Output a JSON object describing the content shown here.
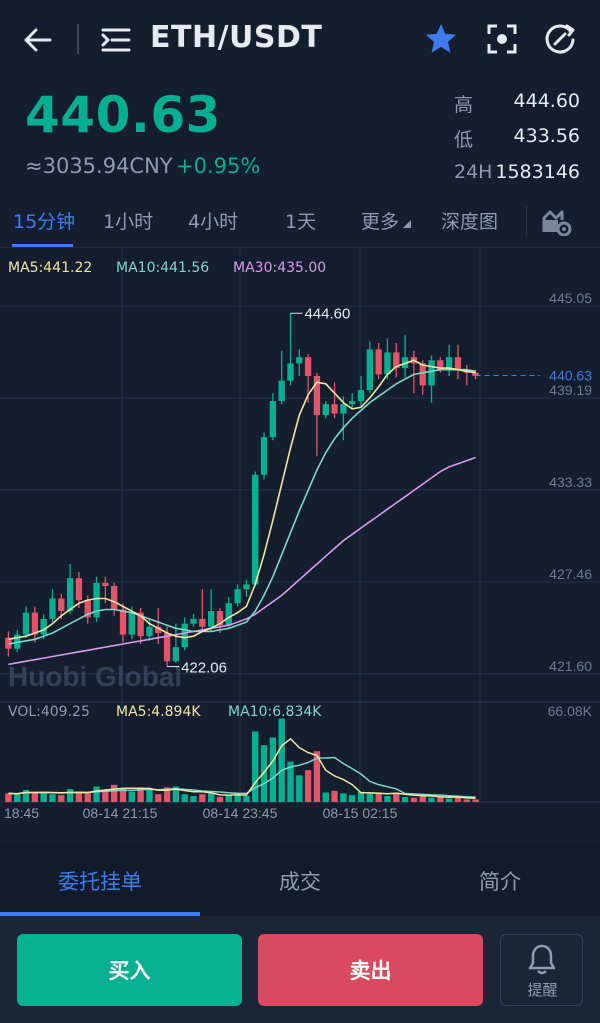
{
  "header": {
    "pair": "ETH/USDT"
  },
  "ticker": {
    "last": "440.63",
    "cny": "≈3035.94CNY",
    "change": "+0.95%",
    "stats": [
      {
        "label": "高",
        "value": "444.60"
      },
      {
        "label": "低",
        "value": "433.56"
      },
      {
        "label": "24H",
        "value": "1583146"
      }
    ]
  },
  "tabs": [
    "15分钟",
    "1小时",
    "4小时",
    "1天",
    "更多",
    "深度图"
  ],
  "chart_legend": {
    "ma5": "MA5:441.22",
    "ma10": "MA10:441.56",
    "ma30": "MA30:435.00",
    "vol": "VOL:409.25",
    "vol_ma5": "MA5:4.894K",
    "vol_ma10": "MA10:6.834K"
  },
  "watermark": "Huobi Global",
  "colors": {
    "up": "#05b092",
    "down": "#e2546a",
    "accent": "#3d7cf0",
    "ma5": "#f3e6a2",
    "ma10": "#7fd8c8",
    "ma30": "#d99af0"
  },
  "chart_data": {
    "type": "candlestick",
    "price_axis": {
      "ticks": [
        "445.05",
        "439.19",
        "433.33",
        "427.46",
        "421.60"
      ],
      "range": [
        419.8,
        448.7
      ]
    },
    "volume_axis": {
      "max_label": "66.08K"
    },
    "x_ticks": [
      "18:45",
      "08-14 21:15",
      "08-14 23:45",
      "08-15 02:15"
    ],
    "high_annotation": "444.60",
    "low_annotation": "422.06",
    "last_price_tag": "440.63",
    "candles": [
      [
        423.9,
        423.2,
        424.3,
        422.7
      ],
      [
        423.2,
        424.1,
        424.4,
        423.0
      ],
      [
        424.1,
        425.5,
        425.9,
        423.9
      ],
      [
        425.5,
        424.1,
        425.9,
        423.6
      ],
      [
        424.1,
        425.1,
        425.4,
        423.8
      ],
      [
        425.1,
        426.4,
        427.0,
        424.9
      ],
      [
        426.4,
        425.6,
        426.7,
        425.1
      ],
      [
        425.6,
        427.7,
        428.6,
        425.4
      ],
      [
        427.7,
        426.3,
        428.1,
        425.8
      ],
      [
        426.3,
        425.2,
        426.6,
        424.8
      ],
      [
        425.2,
        427.4,
        427.8,
        424.9
      ],
      [
        427.4,
        427.2,
        427.8,
        426.1
      ],
      [
        427.2,
        425.7,
        427.4,
        425.3
      ],
      [
        425.7,
        424.1,
        426.1,
        423.6
      ],
      [
        424.1,
        425.5,
        425.9,
        423.8
      ],
      [
        425.5,
        424.0,
        425.8,
        423.5
      ],
      [
        424.0,
        424.6,
        425.1,
        423.7
      ],
      [
        424.6,
        424.2,
        425.8,
        423.5
      ],
      [
        424.2,
        422.4,
        424.6,
        422.06
      ],
      [
        422.4,
        423.3,
        424.8,
        422.3
      ],
      [
        423.3,
        424.8,
        425.2,
        423.1
      ],
      [
        424.8,
        425.1,
        425.4,
        424.6
      ],
      [
        425.1,
        424.6,
        427.0,
        424.3
      ],
      [
        424.6,
        425.6,
        427.0,
        424.3
      ],
      [
        425.6,
        424.7,
        425.8,
        424.2
      ],
      [
        424.7,
        426.1,
        426.5,
        424.6
      ],
      [
        426.1,
        427.0,
        427.3,
        425.9
      ],
      [
        427.0,
        427.3,
        427.6,
        426.5
      ],
      [
        427.3,
        434.3,
        434.5,
        427.2
      ],
      [
        434.3,
        436.7,
        437.0,
        434.0
      ],
      [
        436.7,
        439.0,
        439.5,
        436.5
      ],
      [
        439.0,
        440.3,
        442.2,
        438.8
      ],
      [
        440.3,
        441.4,
        444.6,
        440.0
      ],
      [
        441.4,
        441.8,
        442.3,
        440.6
      ],
      [
        441.8,
        440.6,
        442.0,
        438.9
      ],
      [
        440.6,
        438.1,
        440.8,
        435.5
      ],
      [
        438.1,
        438.8,
        439.0,
        437.9
      ],
      [
        438.8,
        438.2,
        440.2,
        437.9
      ],
      [
        438.2,
        438.8,
        439.3,
        436.5
      ],
      [
        438.8,
        439.0,
        439.5,
        438.5
      ],
      [
        439.0,
        439.7,
        440.6,
        438.6
      ],
      [
        439.7,
        442.3,
        442.8,
        439.5
      ],
      [
        442.3,
        440.7,
        442.7,
        440.4
      ],
      [
        440.7,
        442.1,
        443.0,
        440.4
      ],
      [
        442.1,
        441.1,
        442.7,
        440.5
      ],
      [
        441.1,
        441.8,
        443.2,
        440.5
      ],
      [
        441.8,
        441.4,
        442.2,
        439.5
      ],
      [
        441.4,
        440.0,
        441.6,
        439.4
      ],
      [
        440.0,
        441.6,
        441.9,
        438.9
      ],
      [
        441.6,
        441.0,
        441.8,
        440.8
      ],
      [
        441.0,
        441.8,
        442.6,
        440.6
      ],
      [
        441.8,
        441.0,
        442.6,
        440.4
      ],
      [
        441.0,
        440.8,
        441.3,
        440.0
      ],
      [
        440.8,
        440.6,
        441.0,
        440.4
      ]
    ],
    "volume": [
      0.1,
      0.09,
      0.14,
      0.11,
      0.12,
      0.09,
      0.08,
      0.15,
      0.12,
      0.11,
      0.18,
      0.14,
      0.2,
      0.16,
      0.12,
      0.17,
      0.14,
      0.09,
      0.17,
      0.18,
      0.09,
      0.07,
      0.09,
      0.1,
      0.06,
      0.08,
      0.09,
      0.07,
      0.82,
      0.66,
      0.75,
      0.97,
      0.47,
      0.31,
      0.37,
      0.59,
      0.11,
      0.13,
      0.1,
      0.08,
      0.12,
      0.11,
      0.1,
      0.07,
      0.11,
      0.06,
      0.05,
      0.08,
      0.05,
      0.06,
      0.04,
      0.06,
      0.03,
      0.03
    ],
    "ma5": [
      423.8,
      423.9,
      424.0,
      424.2,
      424.4,
      424.8,
      425.3,
      425.7,
      426.1,
      426.3,
      426.4,
      426.4,
      426.2,
      425.9,
      425.6,
      425.3,
      424.8,
      424.5,
      424.2,
      424.0,
      423.9,
      424.0,
      424.3,
      424.5,
      424.8,
      425.2,
      425.5,
      425.9,
      427.3,
      429.2,
      431.4,
      433.7,
      436.0,
      438.1,
      439.4,
      440.2,
      440.1,
      439.5,
      438.9,
      438.5,
      438.6,
      439.2,
      439.9,
      440.7,
      441.2,
      441.4,
      441.6,
      441.3,
      441.2,
      441.1,
      441.1,
      441.0,
      440.9,
      440.8
    ],
    "ma10": [
      423.5,
      423.6,
      423.7,
      423.8,
      424.0,
      424.2,
      424.5,
      424.8,
      425.1,
      425.4,
      425.6,
      425.7,
      425.7,
      425.6,
      425.5,
      425.3,
      425.1,
      424.9,
      424.7,
      424.5,
      424.4,
      424.3,
      424.3,
      424.3,
      424.4,
      424.5,
      424.7,
      424.9,
      425.6,
      426.6,
      427.8,
      429.2,
      430.6,
      432.0,
      433.3,
      434.6,
      435.7,
      436.6,
      437.3,
      437.9,
      438.4,
      438.9,
      439.3,
      439.7,
      440.1,
      440.4,
      440.7,
      440.8,
      440.9,
      441.0,
      441.0,
      441.0,
      441.0,
      440.9
    ],
    "ma30": [
      422.2,
      422.3,
      422.4,
      422.5,
      422.6,
      422.7,
      422.8,
      422.9,
      423.0,
      423.1,
      423.2,
      423.3,
      423.4,
      423.5,
      423.6,
      423.7,
      423.8,
      423.9,
      424.0,
      424.1,
      424.2,
      424.3,
      424.4,
      424.5,
      424.6,
      424.7,
      424.9,
      425.1,
      425.4,
      425.8,
      426.2,
      426.6,
      427.1,
      427.6,
      428.1,
      428.6,
      429.1,
      429.6,
      430.1,
      430.5,
      430.9,
      431.3,
      431.7,
      432.1,
      432.5,
      432.9,
      433.3,
      433.7,
      434.1,
      434.5,
      434.8,
      435.0,
      435.2,
      435.4
    ]
  },
  "bottom_tabs": [
    "委托挂单",
    "成交",
    "简介"
  ],
  "actions": {
    "buy": "买入",
    "sell": "卖出",
    "alert": "提醒"
  }
}
